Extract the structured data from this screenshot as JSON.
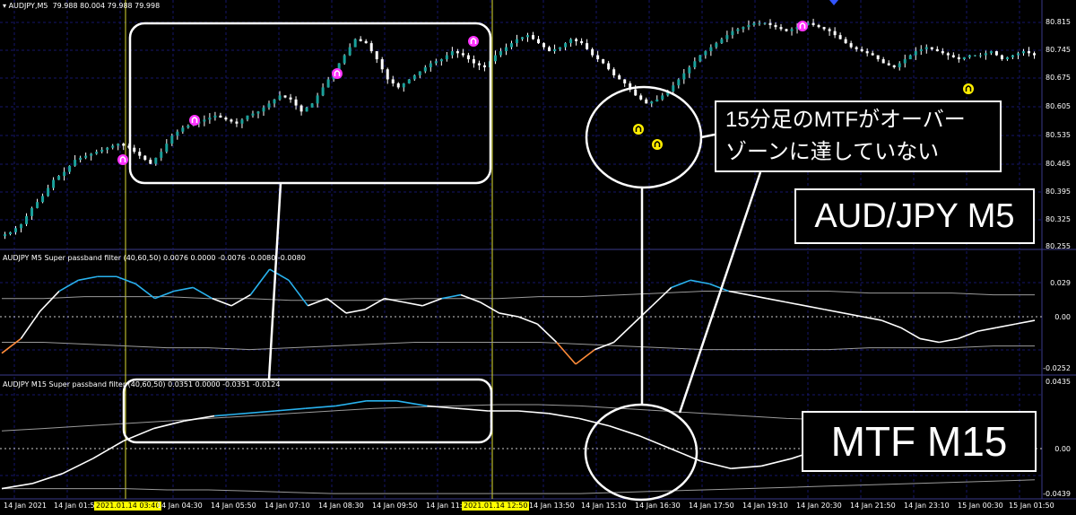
{
  "colors": {
    "grid": "#16166a",
    "candle_body": "#19a09a",
    "indicator_line": "#ffffff",
    "indicator_high": "#29b2ee",
    "indicator_low": "#ff8c3a",
    "marker_sell": "#ff33ff",
    "marker_buy": "#ffee00",
    "vline": "#dddd33"
  },
  "main_panel": {
    "title": "AUDJPY,M5",
    "ohlc": "79.988 80.004 79.988 79.998",
    "price_axis": [
      "80.815",
      "80.745",
      "80.675",
      "80.605",
      "80.535",
      "80.465",
      "80.395",
      "80.325",
      "80.255"
    ],
    "candle_closes": [
      80.28,
      80.3,
      80.34,
      80.37,
      80.41,
      80.43,
      80.46,
      80.47,
      80.48,
      80.49,
      80.5,
      80.49,
      80.47,
      80.45,
      80.48,
      80.52,
      80.54,
      80.55,
      80.56,
      80.57,
      80.56,
      80.55,
      80.57,
      80.58,
      80.6,
      80.62,
      80.61,
      80.58,
      80.6,
      80.64,
      80.68,
      80.72,
      80.76,
      80.75,
      80.71,
      80.66,
      80.64,
      80.66,
      80.68,
      80.7,
      80.71,
      80.73,
      80.72,
      80.7,
      80.69,
      80.72,
      80.74,
      80.76,
      80.77,
      80.75,
      80.73,
      80.74,
      80.76,
      80.75,
      80.72,
      80.7,
      80.67,
      80.65,
      80.62,
      80.6,
      80.61,
      80.63,
      80.66,
      80.69,
      80.72,
      80.74,
      80.76,
      80.78,
      80.79,
      80.8,
      80.8,
      80.79,
      80.78,
      80.79,
      80.8,
      80.79,
      80.78,
      80.76,
      80.74,
      80.73,
      80.72,
      80.7,
      80.69,
      80.71,
      80.73,
      80.74,
      80.73,
      80.72,
      80.71,
      80.72,
      80.72,
      80.73,
      80.71,
      80.72,
      80.73,
      80.72
    ]
  },
  "m5_panel": {
    "title": "AUDJPY M5 Super passband filter (40,60,50) 0.0076 0.0000 -0.0076 -0.0080 -0.0080",
    "axis": [
      "0.029",
      "0.00",
      "-0.0252"
    ],
    "main_line": [
      -0.018,
      -0.01,
      0.005,
      0.016,
      0.022,
      0.024,
      0.024,
      0.02,
      0.012,
      0.016,
      0.018,
      0.012,
      0.008,
      0.014,
      0.028,
      0.022,
      0.008,
      0.012,
      0.004,
      0.006,
      0.012,
      0.01,
      0.008,
      0.012,
      0.014,
      0.01,
      0.004,
      0.002,
      -0.002,
      -0.012,
      -0.024,
      -0.016,
      -0.012,
      -0.002,
      0.008,
      0.018,
      0.022,
      0.02,
      0.016,
      0.014,
      0.012,
      0.01,
      0.008,
      0.006,
      0.004,
      0.002,
      0.0,
      -0.004,
      -0.01,
      -0.012,
      -0.01,
      -0.006,
      -0.004,
      -0.002,
      0.0
    ],
    "upper_band": [
      0.012,
      0.012,
      0.013,
      0.013,
      0.013,
      0.012,
      0.012,
      0.011,
      0.011,
      0.011,
      0.012,
      0.012,
      0.012,
      0.013,
      0.013,
      0.014,
      0.015,
      0.016,
      0.016,
      0.016,
      0.016,
      0.015,
      0.015,
      0.015,
      0.014,
      0.014
    ],
    "lower_band": [
      -0.012,
      -0.012,
      -0.013,
      -0.014,
      -0.015,
      -0.015,
      -0.016,
      -0.015,
      -0.014,
      -0.013,
      -0.012,
      -0.012,
      -0.012,
      -0.012,
      -0.013,
      -0.014,
      -0.015,
      -0.016,
      -0.016,
      -0.016,
      -0.016,
      -0.015,
      -0.015,
      -0.015,
      -0.014,
      -0.014
    ]
  },
  "m15_panel": {
    "title": "AUDJPY M15 Super passband filter (40,60,50) 0.0351 0.0000 -0.0351 -0.0124",
    "axis": [
      "0.0435",
      "0.00",
      "-0.0439"
    ],
    "main_line": [
      -0.04,
      -0.036,
      -0.028,
      -0.016,
      -0.002,
      0.008,
      0.014,
      0.018,
      0.02,
      0.022,
      0.024,
      0.026,
      0.03,
      0.03,
      0.026,
      0.024,
      0.022,
      0.022,
      0.02,
      0.016,
      0.01,
      0.002,
      -0.008,
      -0.018,
      -0.024,
      -0.022,
      -0.016,
      -0.008,
      0.0,
      0.008,
      0.012,
      0.012,
      0.011,
      0.011,
      0.011
    ],
    "upper_band": [
      0.006,
      0.008,
      0.01,
      0.012,
      0.014,
      0.016,
      0.018,
      0.02,
      0.022,
      0.024,
      0.025,
      0.026,
      0.027,
      0.027,
      0.026,
      0.024,
      0.022,
      0.02,
      0.018,
      0.016,
      0.015,
      0.015,
      0.015,
      0.015,
      0.015,
      0.015
    ],
    "lower_band": [
      -0.04,
      -0.04,
      -0.04,
      -0.04,
      -0.041,
      -0.041,
      -0.042,
      -0.043,
      -0.044,
      -0.044,
      -0.044,
      -0.044,
      -0.044,
      -0.044,
      -0.044,
      -0.043,
      -0.042,
      -0.041,
      -0.04,
      -0.039,
      -0.038,
      -0.037,
      -0.036,
      -0.035,
      -0.034,
      -0.033
    ]
  },
  "time_axis": [
    "14 Jan 2021",
    "14 Jan 01:5",
    "2021.01.14 03:40",
    "14 Jan 04:30",
    "14 Jan 05:50",
    "14 Jan 07:10",
    "14 Jan 08:30",
    "14 Jan 09:50",
    "14 Jan 11:",
    "2021.01.14 12:50",
    "14 Jan 13:50",
    "14 Jan 15:10",
    "14 Jan 16:30",
    "14 Jan 17:50",
    "14 Jan 19:10",
    "14 Jan 20:30",
    "14 Jan 21:50",
    "14 Jan 23:10",
    "15 Jan 00:30",
    "15 Jan 01:50"
  ],
  "annotations": {
    "note_line1": "15分足のMTFがオーバー",
    "note_line2": "ゾーンに達していない",
    "main_label": "AUD/JPY M5",
    "mtf_label": "MTF M15"
  }
}
